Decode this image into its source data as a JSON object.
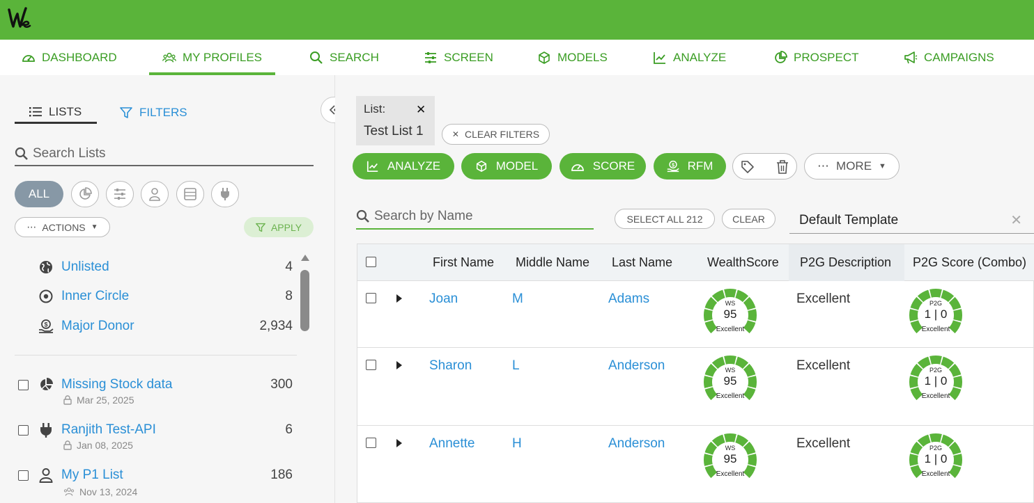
{
  "brand": {
    "color": "#5ab43a",
    "logo_text": "We"
  },
  "nav": {
    "items": [
      {
        "label": "DASHBOARD",
        "icon": "dashboard-gauge-icon"
      },
      {
        "label": "MY PROFILES",
        "icon": "users-icon",
        "active": true
      },
      {
        "label": "SEARCH",
        "icon": "search-icon"
      },
      {
        "label": "SCREEN",
        "icon": "sliders-icon"
      },
      {
        "label": "MODELS",
        "icon": "cube-icon"
      },
      {
        "label": "ANALYZE",
        "icon": "line-chart-icon"
      },
      {
        "label": "PROSPECT",
        "icon": "pie-chart-icon"
      },
      {
        "label": "CAMPAIGNS",
        "icon": "megaphone-icon"
      }
    ]
  },
  "sidebar": {
    "tab_lists": "LISTS",
    "tab_filters": "FILTERS",
    "search_placeholder": "Search Lists",
    "chip_all": "ALL",
    "actions_label": "ACTIONS",
    "apply_label": "APPLY",
    "pinned_lists": [
      {
        "name": "Unlisted",
        "count": "4",
        "icon": "globe-icon"
      },
      {
        "name": "Inner Circle",
        "count": "8",
        "icon": "target-circle-icon"
      },
      {
        "name": "Major Donor",
        "count": "2,934",
        "icon": "donation-hand-icon"
      }
    ],
    "lists": [
      {
        "name": "Missing Stock data",
        "count": "300",
        "date": "Mar 25, 2025",
        "icon": "pie-chart-icon",
        "sub_icon": "lock-icon"
      },
      {
        "name": "Ranjith Test-API",
        "count": "6",
        "date": "Jan 08, 2025",
        "icon": "plug-icon",
        "sub_icon": "lock-icon"
      },
      {
        "name": "My P1 List",
        "count": "186",
        "date": "Nov 13, 2024",
        "icon": "user-icon",
        "sub_icon": "users-icon"
      }
    ]
  },
  "main": {
    "list_chip": {
      "label": "List:",
      "value": "Test List 1"
    },
    "clear_filters": "CLEAR FILTERS",
    "buttons": {
      "analyze": "ANALYZE",
      "model": "MODEL",
      "score": "SCORE",
      "rfm": "RFM",
      "more": "MORE"
    },
    "search_placeholder": "Search by Name",
    "select_all": "SELECT ALL 212",
    "clear": "CLEAR",
    "template": "Default Template",
    "columns": [
      "First Name",
      "Middle Name",
      "Last Name",
      "WealthScore",
      "P2G Description",
      "P2G Score (Combo)"
    ],
    "rows": [
      {
        "first": "Joan",
        "middle": "M",
        "last": "Adams",
        "ws_label": "WS",
        "ws_value": "95",
        "ws_desc": "Excellent",
        "p2g_desc": "Excellent",
        "p2g_label": "P2G",
        "p2g_value": "1 | 0",
        "p2g_gauge_desc": "Excellent"
      },
      {
        "first": "Sharon",
        "middle": "L",
        "last": "Anderson",
        "ws_label": "WS",
        "ws_value": "95",
        "ws_desc": "Excellent",
        "p2g_desc": "Excellent",
        "p2g_label": "P2G",
        "p2g_value": "1 | 0",
        "p2g_gauge_desc": "Excellent"
      },
      {
        "first": "Annette",
        "middle": "H",
        "last": "Anderson",
        "ws_label": "WS",
        "ws_value": "95",
        "ws_desc": "Excellent",
        "p2g_desc": "Excellent",
        "p2g_label": "P2G",
        "p2g_value": "1 | 0",
        "p2g_gauge_desc": "Excellent"
      }
    ]
  }
}
